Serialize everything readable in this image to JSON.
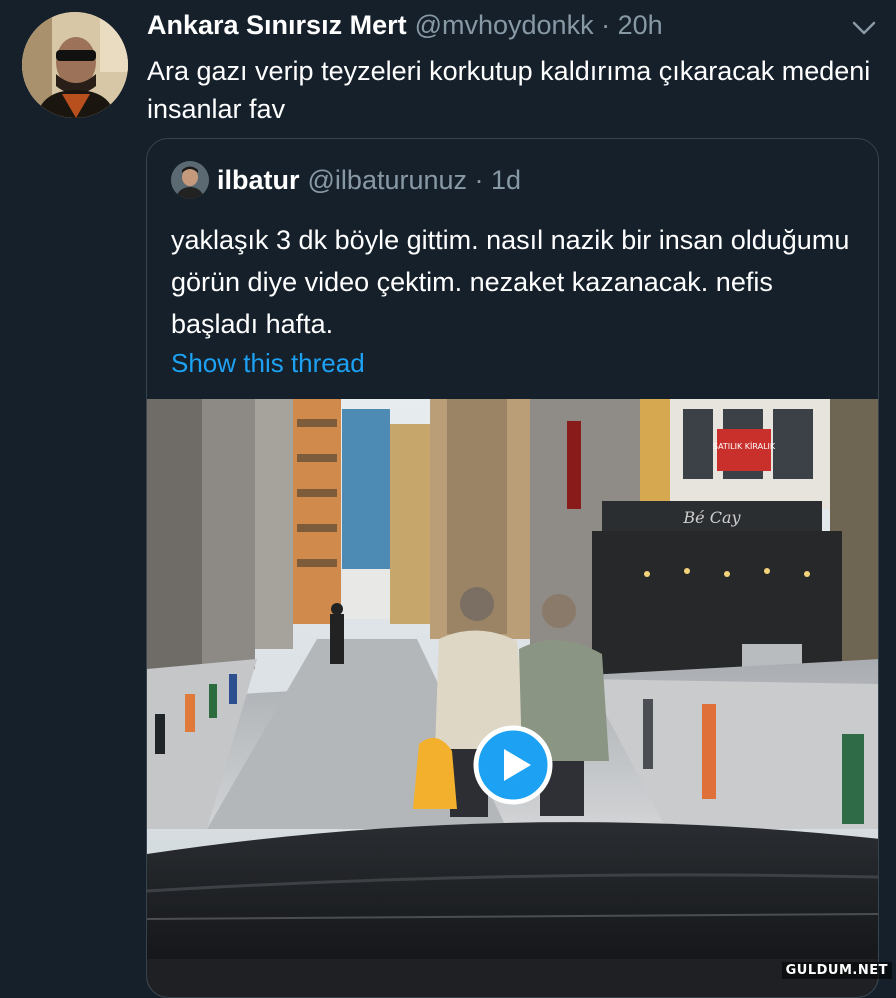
{
  "tweet": {
    "author_name": "Ankara Sınırsız Mert",
    "author_handle": "@mvhoydonkk · 20h",
    "text": "Ara gazı verip teyzeleri korkutup kaldırıma çıkaracak medeni insanlar fav"
  },
  "quoted_tweet": {
    "author_name": "ilbatur",
    "author_handle": "@ilbaturunuz · 1d",
    "text": "yaklaşık 3 dk böyle gittim. nasıl nazik bir insan olduğumu görün diye video çektim. nezaket kazanacak. nefis başladı hafta.",
    "show_thread": "Show this thread"
  },
  "video": {
    "cafe_sign": "Bé Cay",
    "shop_sign": "SATILIK KİRALIK"
  },
  "watermark": "GULDUM.NET",
  "colors": {
    "background": "#15202b",
    "link": "#1da1f2",
    "secondary_text": "#8899a6",
    "play_button": "#1da1f2"
  },
  "icons": [
    "chevron-down-icon",
    "play-icon"
  ]
}
